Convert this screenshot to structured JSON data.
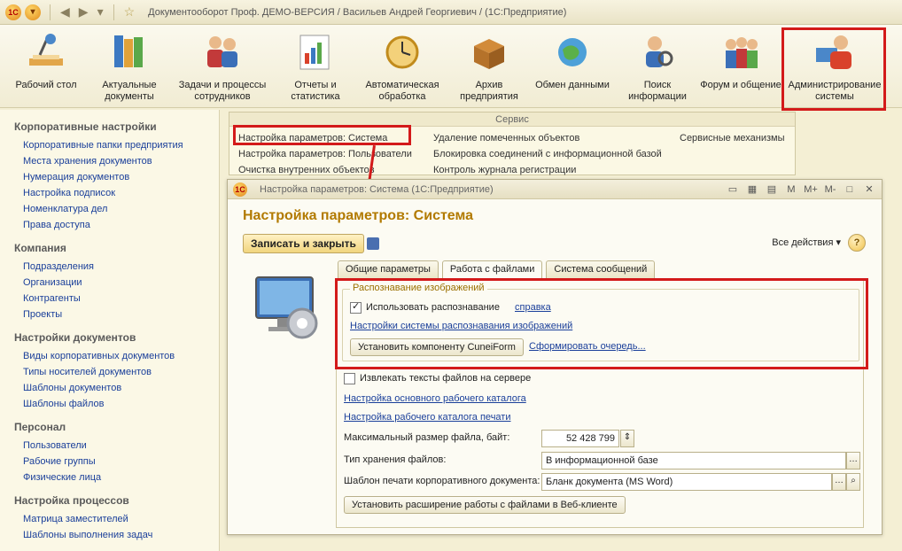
{
  "window": {
    "title": "Документооборот Проф. ДЕМО-ВЕРСИЯ / Васильев Андрей Георгиевич / (1С:Предприятие)",
    "logo": "1С"
  },
  "toolbar": {
    "items": [
      {
        "label": "Рабочий стол",
        "icon": "desk-lamp-icon"
      },
      {
        "label": "Актуальные документы",
        "icon": "binders-icon"
      },
      {
        "label": "Задачи и процессы сотрудников",
        "icon": "people-icon"
      },
      {
        "label": "Отчеты и статистика",
        "icon": "reports-icon"
      },
      {
        "label": "Автоматическая обработка",
        "icon": "clock-icon"
      },
      {
        "label": "Архив предприятия",
        "icon": "archive-box-icon"
      },
      {
        "label": "Обмен данными",
        "icon": "globe-exchange-icon"
      },
      {
        "label": "Поиск информации",
        "icon": "search-person-icon"
      },
      {
        "label": "Форум и общение",
        "icon": "forum-people-icon"
      },
      {
        "label": "Администрирование системы",
        "icon": "admin-person-icon"
      }
    ]
  },
  "sidebar": {
    "groups": [
      {
        "title": "Корпоративные настройки",
        "items": [
          "Корпоративные папки предприятия",
          "Места хранения документов",
          "Нумерация документов",
          "Настройка подписок",
          "Номенклатура дел",
          "Права доступа"
        ]
      },
      {
        "title": "Компания",
        "items": [
          "Подразделения",
          "Организации",
          "Контрагенты",
          "Проекты"
        ]
      },
      {
        "title": "Настройки документов",
        "items": [
          "Виды корпоративных документов",
          "Типы носителей документов",
          "Шаблоны документов",
          "Шаблоны файлов"
        ]
      },
      {
        "title": "Персонал",
        "items": [
          "Пользователи",
          "Рабочие группы",
          "Физические лица"
        ]
      },
      {
        "title": "Настройка процессов",
        "items": [
          "Матрица заместителей",
          "Шаблоны выполнения задач"
        ]
      }
    ]
  },
  "service": {
    "title": "Сервис",
    "col1": [
      "Настройка параметров: Система",
      "Настройка параметров: Пользователи",
      "Очистка внутренних объектов"
    ],
    "col2": [
      "Удаление помеченных объектов",
      "Блокировка соединений с информационной базой",
      "Контроль журнала регистрации"
    ],
    "col3": [
      "Сервисные механизмы"
    ]
  },
  "dialog": {
    "bar_title": "Настройка параметров: Система (1С:Предприятие)",
    "title": "Настройка параметров: Система",
    "save_close": "Записать и закрыть",
    "all_actions": "Все действия ▾",
    "help": "?",
    "ctrl_labels": [
      "M",
      "M+",
      "M-"
    ],
    "tabs": [
      "Общие параметры",
      "Работа с файлами",
      "Система сообщений"
    ],
    "recognition": {
      "legend": "Распознавание изображений",
      "use_label": "Использовать распознавание",
      "use_checked": true,
      "help_link": "справка",
      "settings_link": "Настройки системы распознавания изображений",
      "install_btn": "Установить компоненту CuneiForm",
      "queue_link": "Сформировать очередь..."
    },
    "extract_label": "Извлекать тексты файлов на сервере",
    "main_catalog_link": "Настройка основного рабочего каталога",
    "print_catalog_link": "Настройка рабочего каталога печати",
    "max_size_label": "Максимальный размер файла, байт:",
    "max_size_value": "52 428 799",
    "storage_label": "Тип хранения файлов:",
    "storage_value": "В информационной базе",
    "template_label": "Шаблон печати корпоративного документа:",
    "template_value": "Бланк документа (MS Word)",
    "web_ext_btn": "Установить расширение работы с файлами в Веб-клиенте"
  },
  "colors": {
    "highlight": "#d31a1a",
    "link": "#1a3f9a",
    "title": "#b27a00"
  }
}
